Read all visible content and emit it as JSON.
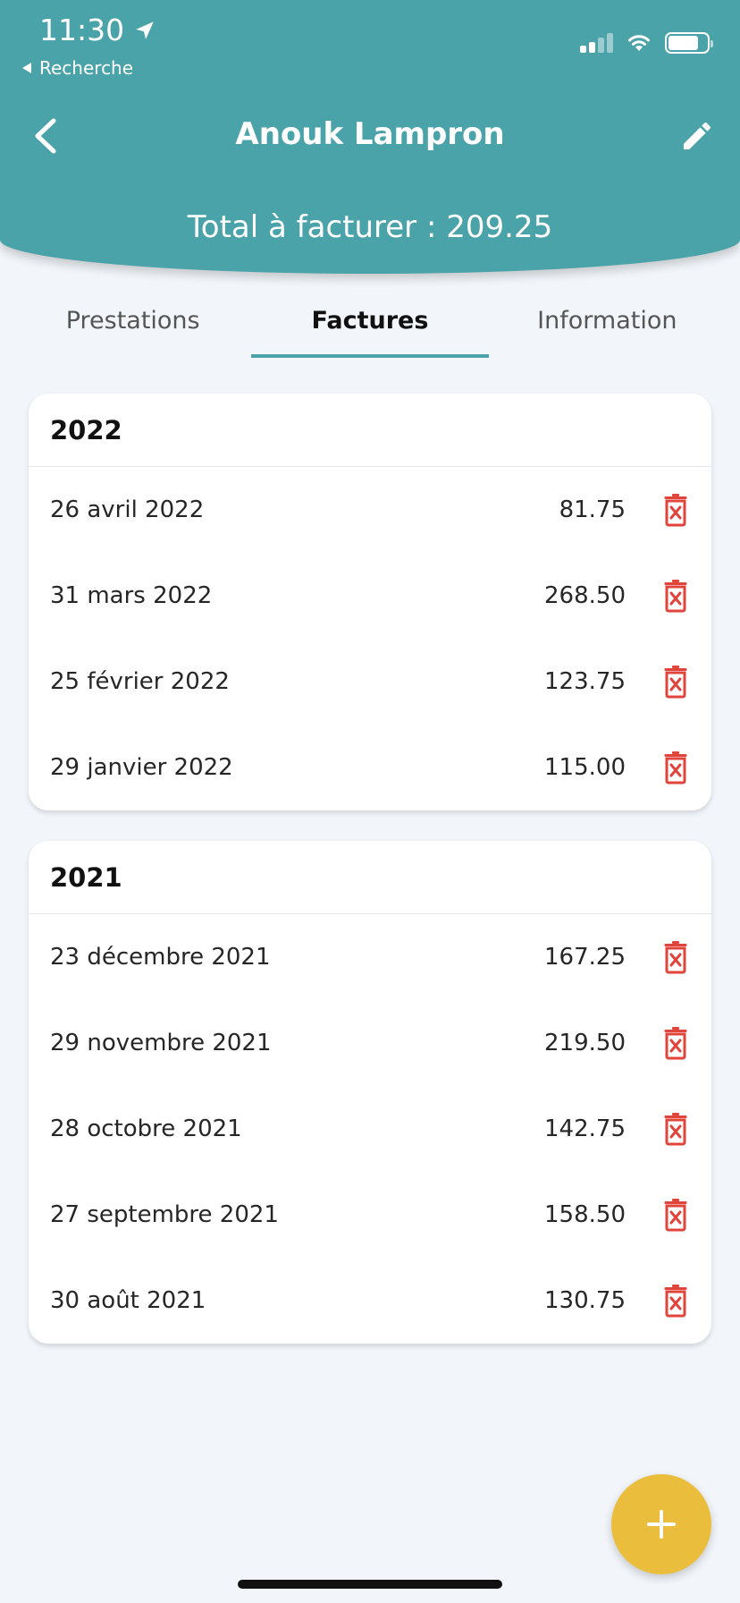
{
  "status_bar": {
    "time": "11:30",
    "back_label": "Recherche"
  },
  "header": {
    "title": "Anouk Lampron",
    "total": "Total à facturer : 209.25"
  },
  "tabs": [
    {
      "label": "Prestations",
      "active": false
    },
    {
      "label": "Factures",
      "active": true
    },
    {
      "label": "Information",
      "active": false
    }
  ],
  "groups": [
    {
      "year": "2022",
      "invoices": [
        {
          "date": "26 avril 2022",
          "amount": "81.75"
        },
        {
          "date": "31 mars 2022",
          "amount": "268.50"
        },
        {
          "date": "25 février 2022",
          "amount": "123.75"
        },
        {
          "date": "29 janvier 2022",
          "amount": "115.00"
        }
      ]
    },
    {
      "year": "2021",
      "invoices": [
        {
          "date": "23 décembre 2021",
          "amount": "167.25"
        },
        {
          "date": "29 novembre 2021",
          "amount": "219.50"
        },
        {
          "date": "28 octobre 2021",
          "amount": "142.75"
        },
        {
          "date": "27 septembre 2021",
          "amount": "158.50"
        },
        {
          "date": "30 août 2021",
          "amount": "130.75"
        }
      ]
    }
  ],
  "icons": {
    "back": "chevron-left-icon",
    "edit": "pencil-icon",
    "delete": "trash-x-icon",
    "add": "plus-icon"
  },
  "colors": {
    "header": "#4ba3aa",
    "tab_indicator": "#4ba3aa",
    "delete": "#e0443a",
    "fab": "#ebbd3d",
    "background": "#f2f6fa"
  }
}
